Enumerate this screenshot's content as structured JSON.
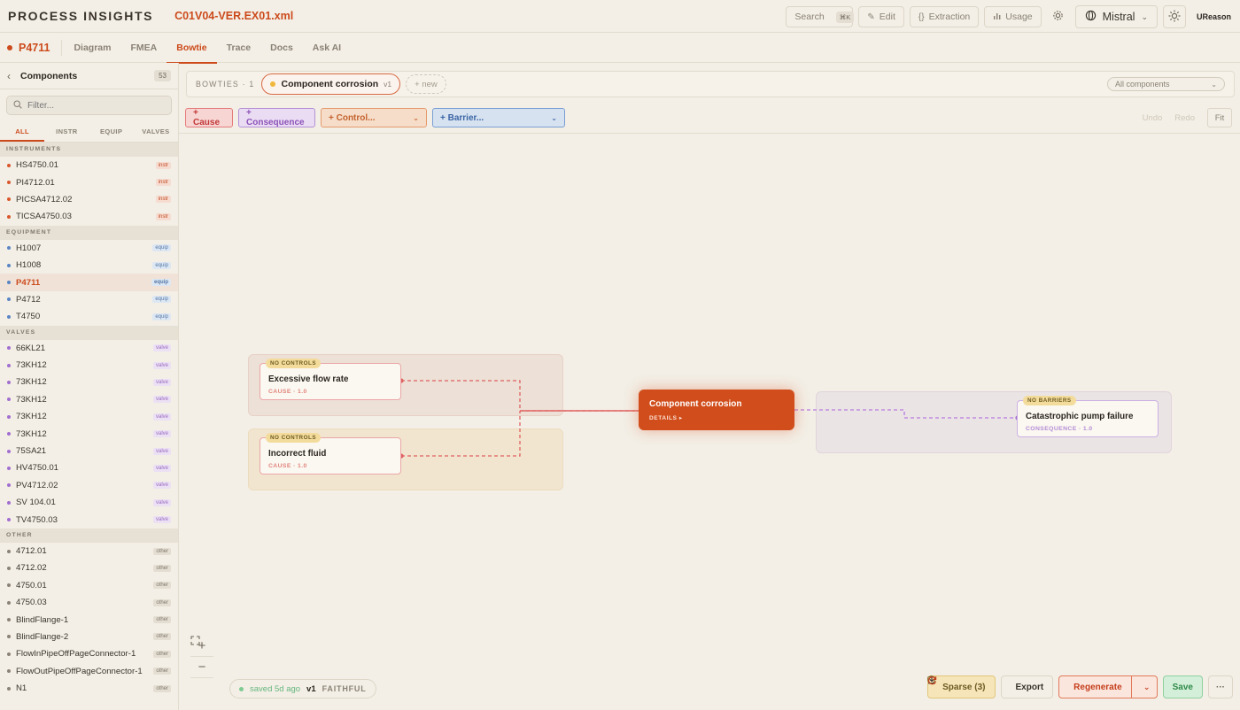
{
  "topbar": {
    "brand": "PROCESS INSIGHTS",
    "file": "C01V04-VER.EX01.xml",
    "search_label": "Search",
    "search_kbd": "⌘K",
    "edit_label": "Edit",
    "extraction_label": "Extraction",
    "usage_label": "Usage",
    "model_label": "Mistral",
    "user_label": "UReason"
  },
  "nav": {
    "project": "P4711",
    "tabs": [
      {
        "label": "Diagram",
        "active": false
      },
      {
        "label": "FMEA",
        "active": false
      },
      {
        "label": "Bowtie",
        "active": true
      },
      {
        "label": "Trace",
        "active": false
      },
      {
        "label": "Docs",
        "active": false
      },
      {
        "label": "Ask AI",
        "active": false
      }
    ]
  },
  "sidebar": {
    "title": "Components",
    "count": "53",
    "filter_placeholder": "Filter...",
    "filter_tabs": [
      "ALL",
      "INSTR",
      "EQUIP",
      "VALVES"
    ],
    "groups": [
      {
        "label": "INSTRUMENTS",
        "items": [
          {
            "name": "HS4750.01",
            "badge": "instr"
          },
          {
            "name": "PI4712.01",
            "badge": "instr"
          },
          {
            "name": "PICSA4712.02",
            "badge": "instr"
          },
          {
            "name": "TICSA4750.03",
            "badge": "instr"
          }
        ]
      },
      {
        "label": "EQUIPMENT",
        "items": [
          {
            "name": "H1007",
            "badge": "equip"
          },
          {
            "name": "H1008",
            "badge": "equip"
          },
          {
            "name": "P4711",
            "badge": "equip",
            "active": true
          },
          {
            "name": "P4712",
            "badge": "equip"
          },
          {
            "name": "T4750",
            "badge": "equip"
          }
        ]
      },
      {
        "label": "VALVES",
        "items": [
          {
            "name": "66KL21",
            "badge": "valve"
          },
          {
            "name": "73KH12",
            "badge": "valve"
          },
          {
            "name": "73KH12",
            "badge": "valve"
          },
          {
            "name": "73KH12",
            "badge": "valve"
          },
          {
            "name": "73KH12",
            "badge": "valve"
          },
          {
            "name": "73KH12",
            "badge": "valve"
          },
          {
            "name": "75SA21",
            "badge": "valve"
          },
          {
            "name": "HV4750.01",
            "badge": "valve"
          },
          {
            "name": "PV4712.02",
            "badge": "valve"
          },
          {
            "name": "SV 104.01",
            "badge": "valve"
          },
          {
            "name": "TV4750.03",
            "badge": "valve"
          }
        ]
      },
      {
        "label": "OTHER",
        "items": [
          {
            "name": "4712.01",
            "badge": "other"
          },
          {
            "name": "4712.02",
            "badge": "other"
          },
          {
            "name": "4750.01",
            "badge": "other"
          },
          {
            "name": "4750.03",
            "badge": "other"
          },
          {
            "name": "BlindFlange-1",
            "badge": "other"
          },
          {
            "name": "BlindFlange-2",
            "badge": "other"
          },
          {
            "name": "FlowInPipeOffPageConnector-1",
            "badge": "other"
          },
          {
            "name": "FlowOutPipeOffPageConnector-1",
            "badge": "other"
          },
          {
            "name": "N1",
            "badge": "other"
          }
        ]
      }
    ]
  },
  "bowbar": {
    "label": "BOWTIES · 1",
    "active_bowtie": "Component corrosion",
    "active_version": "v1",
    "new_label": "+ new",
    "filter_label": "All components"
  },
  "toolbar": {
    "cause": "+ Cause",
    "consequence": "+ Consequence",
    "control": "+ Control...",
    "barrier": "+ Barrier...",
    "undo": "Undo",
    "redo": "Redo",
    "fit": "Fit"
  },
  "diagram": {
    "causes": [
      {
        "tag": "NO CONTROLS",
        "title": "Excessive flow rate",
        "sub": "CAUSE · 1.0"
      },
      {
        "tag": "NO CONTROLS",
        "title": "Incorrect fluid",
        "sub": "CAUSE · 1.0"
      }
    ],
    "top_event": {
      "title": "Component corrosion",
      "details": "DETAILS ▸"
    },
    "consequences": [
      {
        "tag": "NO BARRIERS",
        "title": "Catastrophic pump failure",
        "sub": "CONSEQUENCE · 1.0"
      }
    ]
  },
  "status": {
    "saved": "saved 5d ago",
    "version": "v1",
    "mode": "FAITHFUL"
  },
  "actions": {
    "sparse": "Sparse (3)",
    "export": "Export",
    "regenerate": "Regenerate",
    "save": "Save"
  },
  "colors": {
    "accent": "#cc4a1c",
    "instr": "#d9572b",
    "equip": "#5a84c4",
    "valve": "#a26ed0",
    "other": "#8a8276"
  }
}
